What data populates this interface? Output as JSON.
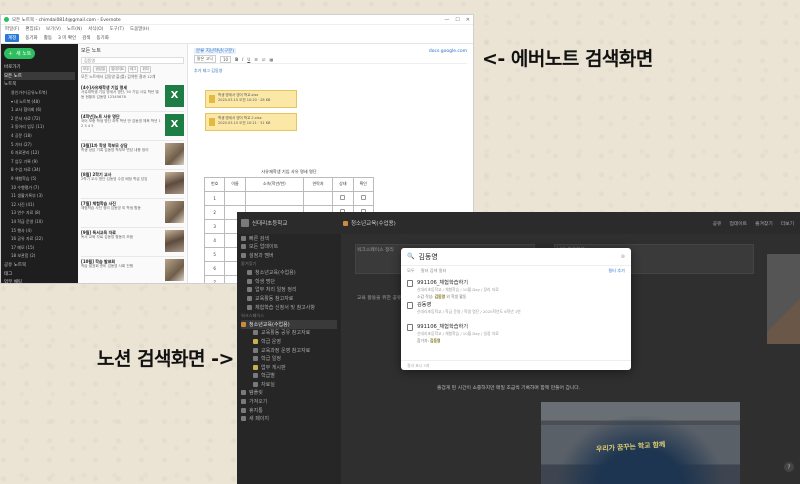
{
  "labels": {
    "evernote": "<- 에버노트 검색화면",
    "notion": "노션 검색화면 ->"
  },
  "evernote": {
    "title": "모든 노트북 - chimdai0814@gmail.com - Evernote",
    "window_controls": [
      "—",
      "☐",
      "✕"
    ],
    "menu": [
      "파일(F)",
      "편집(E)",
      "보기(V)",
      "노트(N)",
      "서식(O)",
      "도구(T)",
      "도움말(H)"
    ],
    "toolbar": {
      "account": "계정",
      "items": [
        "동기화",
        "활동",
        "3 미 확인",
        "검색",
        "동기화"
      ]
    },
    "sidebar": {
      "new_note": "새 노트",
      "items": [
        {
          "label": "바로가기",
          "kind": "top"
        },
        {
          "label": "모든 노트",
          "kind": "sel"
        },
        {
          "label": "노트북",
          "kind": "top"
        },
        {
          "label": "용인가수(공유노트북)",
          "kind": "sub"
        },
        {
          "label": "▾ 내 노트북 (48)",
          "kind": "sub"
        },
        {
          "label": "1 교사 협의회 (6)",
          "kind": "sub"
        },
        {
          "label": "2 문서 자료 (72)",
          "kind": "sub"
        },
        {
          "label": "3 동아리 업무 (11)",
          "kind": "sub"
        },
        {
          "label": "4 공문 (18)",
          "kind": "sub"
        },
        {
          "label": "5 기타 (27)",
          "kind": "sub"
        },
        {
          "label": "6 자료관리 (12)",
          "kind": "sub"
        },
        {
          "label": "7 업무 기록 (9)",
          "kind": "sub"
        },
        {
          "label": "8 수업 자료 (34)",
          "kind": "sub"
        },
        {
          "label": "9 체험학습 (5)",
          "kind": "sub"
        },
        {
          "label": "10 수행평가 (7)",
          "kind": "sub"
        },
        {
          "label": "11 생활기록부 (3)",
          "kind": "sub"
        },
        {
          "label": "12 사진 (41)",
          "kind": "sub"
        },
        {
          "label": "13 연수 자료 (8)",
          "kind": "sub"
        },
        {
          "label": "14 학급 운영 (10)",
          "kind": "sub"
        },
        {
          "label": "15 행사 (4)",
          "kind": "sub"
        },
        {
          "label": "16 공유 자료 (22)",
          "kind": "sub"
        },
        {
          "label": "17 메모 (15)",
          "kind": "sub"
        },
        {
          "label": "18 보관함 (2)",
          "kind": "sub"
        },
        {
          "label": "공유 노트북",
          "kind": "top"
        },
        {
          "label": "태그",
          "kind": "top"
        },
        {
          "label": "업무 채팅",
          "kind": "top"
        },
        {
          "label": "휴지통 (10)",
          "kind": "top"
        }
      ]
    },
    "list": {
      "title": "모든 노트",
      "search": "김동영",
      "filters": [
        "모두",
        "생성일",
        "업데이트",
        "태그",
        "위치"
      ],
      "info": "모든 노트에서 김동영 을(를) 검색한 결과 12개",
      "notes": [
        {
          "title": "[4수]사유재학생 기입 명세",
          "body": "사유재학생 기입 명세서 명단, 50 기입 사유 학년 별 동 현황과 김동영 12345678",
          "thumb": "xl"
        },
        {
          "title": "[4학년]노트 사유 명단",
          "body": "국어 보충 학생 명단 과학 학년 반 김동영 체육 학년 1 2 3 4 5",
          "thumb": "xl"
        },
        {
          "title": "[3월]1차 학생 학부모 상담",
          "body": "학생 상담 기록 김동영 학부모 면담 내용 정리",
          "thumb": "ph"
        },
        {
          "title": "[8월] 2학기 교사",
          "body": "2학기 교사 명단 김동영 수업 배정 학급 담임",
          "thumb": "ph2"
        },
        {
          "title": "[7월] 체험학습 사진",
          "body": "체험학습 사진 정리 김동영 외 학생 활동",
          "thumb": "ph"
        },
        {
          "title": "[9월] 독서교육 자료",
          "body": "독서 교육 자료 김동영 활동지 모음",
          "thumb": "ph2"
        },
        {
          "title": "[10월] 학습 발표회",
          "body": "학습 발표회 준비 김동영 사회 진행",
          "thumb": "ph"
        },
        {
          "title": "[11월] 동아리 활동",
          "body": "동아리 활동 기록 김동영 회의록",
          "thumb": "ph2"
        }
      ]
    },
    "doc": {
      "title": "[4수]사유재학생 기입 명세서 명단",
      "tag": "분류 지난학년(구분)",
      "share": "docs.google.com",
      "font": "맑은 고딕",
      "size": "10",
      "tagline": "추가 태그 김동영",
      "attachments": [
        {
          "name": "학생 명세서 영어 학교.xlsx",
          "meta": "2020.03.15 오전 10:20 · 28 KB"
        },
        {
          "name": "학생 명세서 영어 학교 2.xlsx",
          "meta": "2020.03.15 오전 10:21 · 31 KB"
        }
      ],
      "table": {
        "caption": "사유재학생 기입 사유 명세 명단",
        "headers": [
          "번호",
          "이름",
          "소속(학년/반)",
          "연락처",
          "상태",
          "확인"
        ],
        "rows": [
          "1",
          "2",
          "3",
          "4",
          "5",
          "6",
          "7",
          "8"
        ]
      }
    }
  },
  "notion": {
    "workspace": "신대리초등학교",
    "breadcrumb": "청소년교육(수업용)",
    "top_actions": [
      "공유",
      "업데이트",
      "즐겨찾기",
      "더보기"
    ],
    "sidebar": {
      "items": [
        {
          "label": "빠른 검색",
          "kind": "row"
        },
        {
          "label": "모든 업데이트",
          "kind": "row"
        },
        {
          "label": "설정과 멤버",
          "kind": "row"
        },
        {
          "label": "즐겨찾기",
          "kind": "hd"
        },
        {
          "label": "청소년교육(수업용)",
          "kind": "in1"
        },
        {
          "label": "학생 명단",
          "kind": "in1"
        },
        {
          "label": "업무 처리 일정 정리",
          "kind": "in1"
        },
        {
          "label": "교육활동 참고자료",
          "kind": "in1"
        },
        {
          "label": "체험학습 신청서 및 참고사항",
          "kind": "in1"
        },
        {
          "label": "워크스페이스",
          "kind": "hd"
        },
        {
          "label": "청소년교육(수업용)",
          "kind": "sel"
        },
        {
          "label": "교육활동 공유 참고자료",
          "kind": "in2"
        },
        {
          "label": "학급 운영",
          "kind": "in2"
        },
        {
          "label": "교육과정 운영 참고자료",
          "kind": "in2"
        },
        {
          "label": "학급 일정",
          "kind": "in2"
        },
        {
          "label": "업무 게시판",
          "kind": "in2"
        },
        {
          "label": "학급별",
          "kind": "in2"
        },
        {
          "label": "자료실",
          "kind": "in2"
        },
        {
          "label": "템플릿",
          "kind": "row"
        },
        {
          "label": "가져오기",
          "kind": "row"
        },
        {
          "label": "휴지통",
          "kind": "row"
        },
        {
          "label": "새 페이지",
          "kind": "row"
        }
      ]
    },
    "main_text": [
      "워크스페이스 정리",
      "나의 프로젝트",
      "교육 활동을 위한 공유 공간입니다."
    ],
    "caption": "즐겁게 된 시간이 소중하지만 매일 조금씩 기록하며 함께 만들어 갑니다.",
    "banner": "우리가 꿈꾸는 학교 함께",
    "search": {
      "query": "김동영",
      "options": [
        "모두",
        "필터 검색 필터"
      ],
      "filter": "필터 추가",
      "results": [
        {
          "title": "991106_체험학습하기",
          "path": "신대리초등학교 / 체험학습 / 10월 Day / 정리 자료",
          "snippet_pre": "소감 작성: ",
          "snippet_hl": "김동영",
          "snippet_post": " 외 학생 활동"
        },
        {
          "title": "김동영",
          "path": "신대리초등학교 / 학급 운영 / 학생 명단 / 2020학년도 6학년 1반",
          "snippet_pre": "",
          "snippet_hl": "",
          "snippet_post": ""
        },
        {
          "title": "991106_체험학습하기",
          "path": "신대리초등학교 / 체험학습 / 10월 Day / 일정 자료",
          "snippet_pre": "참가자: ",
          "snippet_hl": "김동영",
          "snippet_post": ""
        }
      ],
      "footer": "결과 표시 3개"
    }
  }
}
